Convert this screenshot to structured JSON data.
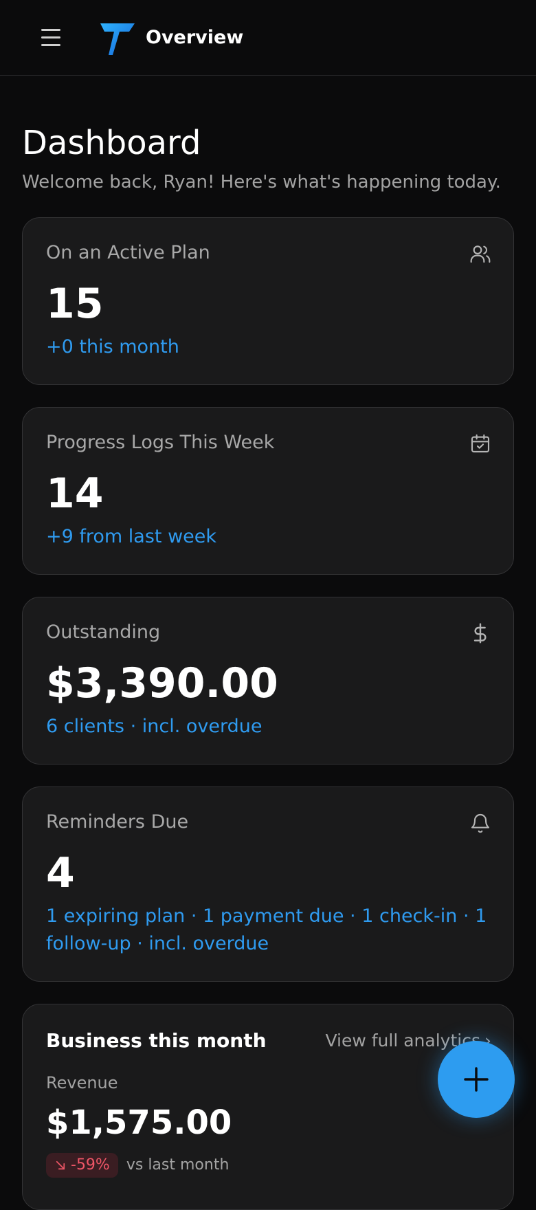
{
  "topbar": {
    "title": "Overview",
    "menu_icon": "menu-icon",
    "logo_icon": "brand-logo-icon"
  },
  "page": {
    "title": "Dashboard",
    "subtitle": "Welcome back, Ryan! Here's what's happening today."
  },
  "stats": {
    "plan": {
      "label": "On an Active Plan",
      "value": "15",
      "note": "+0 this month",
      "icon": "users-icon"
    },
    "logs": {
      "label": "Progress Logs This Week",
      "value": "14",
      "note": "+9 from last week",
      "icon": "calendar-check-icon"
    },
    "outstanding": {
      "label": "Outstanding",
      "value": "$3,390.00",
      "note": "6 clients · incl. overdue",
      "icon": "dollar-icon"
    },
    "reminders": {
      "label": "Reminders Due",
      "value": "4",
      "note": "1 expiring plan · 1 payment due · 1 check-in · 1 follow-up · incl. overdue",
      "icon": "bell-icon"
    }
  },
  "business": {
    "title": "Business this month",
    "link_label": "View full analytics",
    "revenue_label": "Revenue",
    "revenue_value": "$1,575.00",
    "change": "-59%",
    "change_note": "vs last month"
  },
  "fab": {
    "icon": "plus-icon"
  },
  "colors": {
    "background": "#0b0b0c",
    "card": "#1a1a1b",
    "accent": "#2f9bf0",
    "negative": "#ef5667"
  }
}
